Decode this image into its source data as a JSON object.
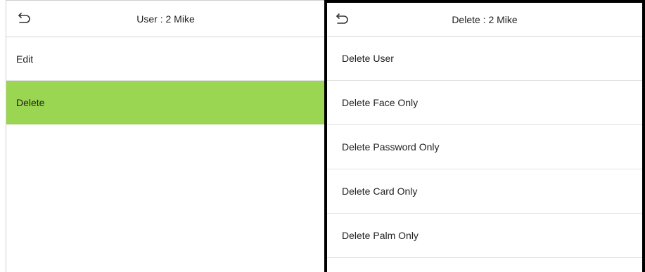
{
  "left": {
    "title": "User : 2 Mike",
    "back_icon": "back-arrow-icon",
    "items": [
      {
        "label": "Edit",
        "selected": false
      },
      {
        "label": "Delete",
        "selected": true
      }
    ],
    "highlight_color": "#9ad651"
  },
  "right": {
    "title": "Delete : 2 Mike",
    "back_icon": "back-arrow-icon",
    "items": [
      {
        "label": "Delete User"
      },
      {
        "label": "Delete Face Only"
      },
      {
        "label": "Delete Password Only"
      },
      {
        "label": "Delete Card Only"
      },
      {
        "label": "Delete Palm Only"
      }
    ]
  }
}
